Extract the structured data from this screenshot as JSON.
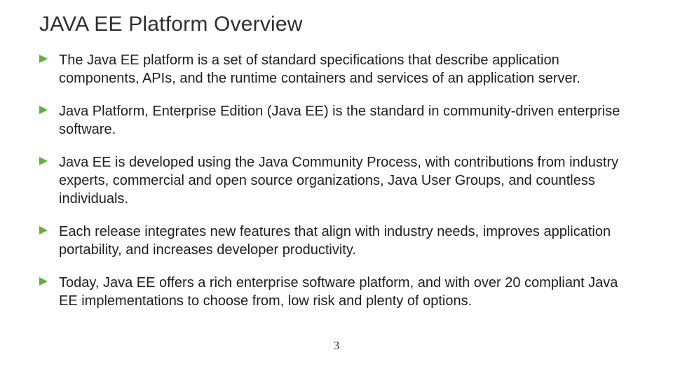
{
  "title": "JAVA EE Platform Overview",
  "accent": "#5fb336",
  "page_number": "3",
  "bullets": [
    "The Java EE platform is a set of standard specifications that describe application components, APIs, and the runtime containers and services of an application server.",
    "Java Platform, Enterprise Edition (Java EE) is the standard in community-driven enterprise software.",
    "Java EE is developed using the Java Community Process, with contributions from industry experts, commercial and open source organizations, Java User Groups, and countless individuals.",
    "Each release integrates new features that align with industry needs, improves application portability, and increases developer productivity.",
    "Today, Java EE offers a rich enterprise software platform,  and with over 20 compliant Java EE  implementations to choose from, low risk and plenty of options."
  ]
}
